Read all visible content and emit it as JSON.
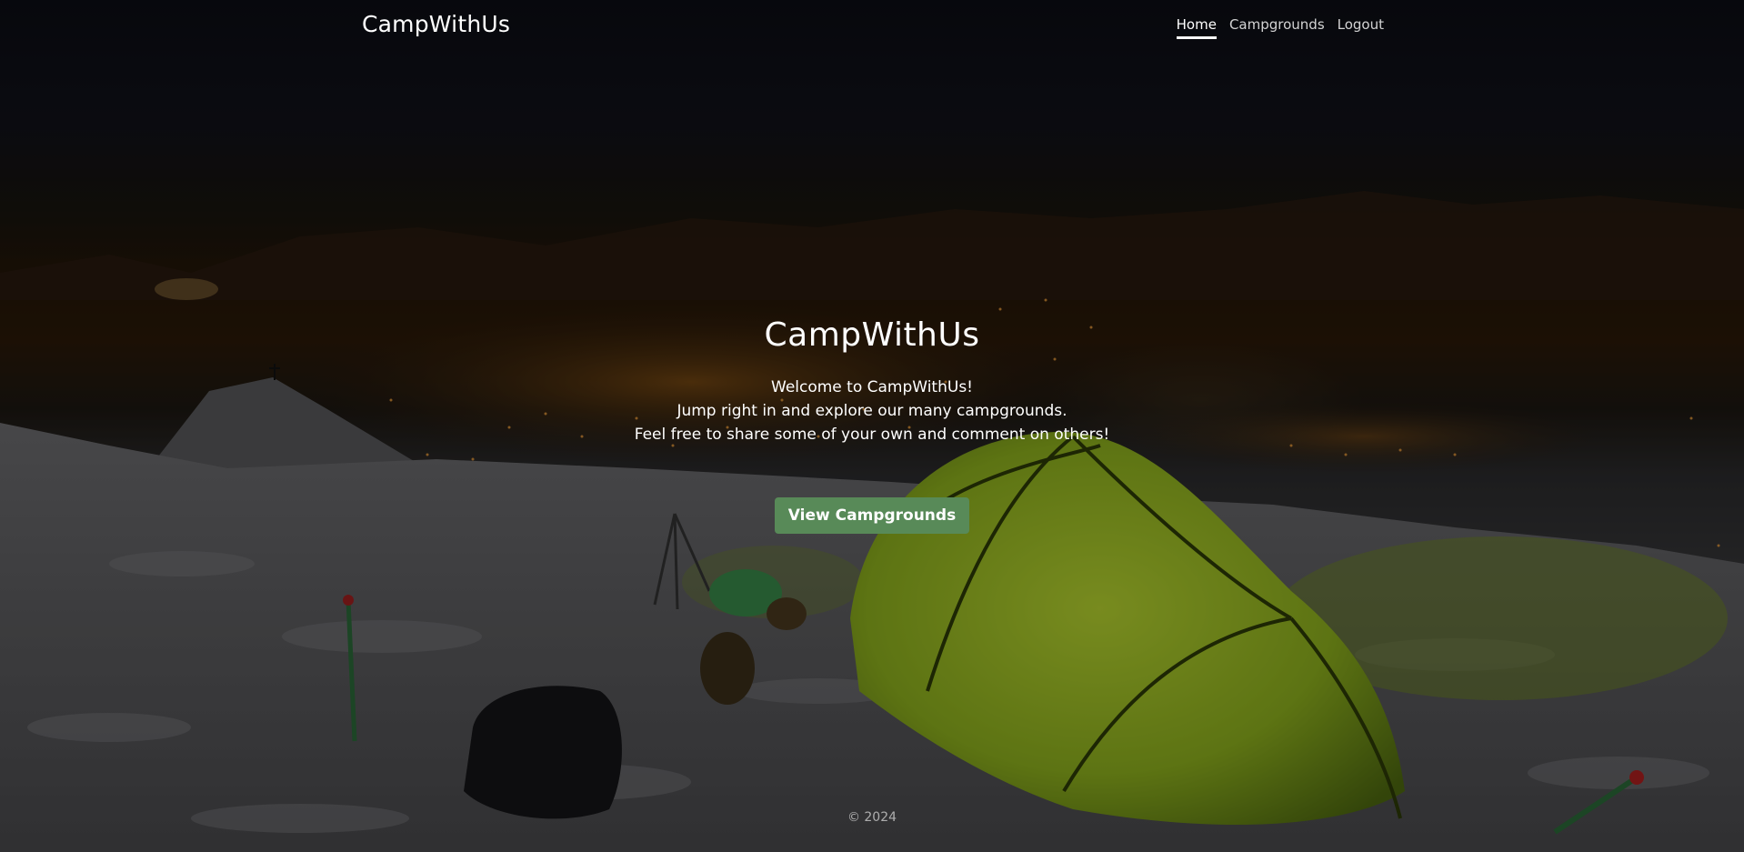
{
  "app": {
    "brand": "CampWithUs"
  },
  "nav": {
    "items": [
      {
        "label": "Home",
        "active": true
      },
      {
        "label": "Campgrounds",
        "active": false
      },
      {
        "label": "Logout",
        "active": false
      }
    ]
  },
  "hero": {
    "title": "CampWithUs",
    "lines": [
      "Welcome to CampWithUs!",
      "Jump right in and explore our many campgrounds.",
      "Feel free to share some of your own and comment on others!"
    ],
    "button_label": "View Campgrounds"
  },
  "footer": {
    "text": "© 2024"
  },
  "colors": {
    "accent_button": "#588a58",
    "tent_green": "#8fb21e",
    "city_lights": "#e89a3a"
  }
}
